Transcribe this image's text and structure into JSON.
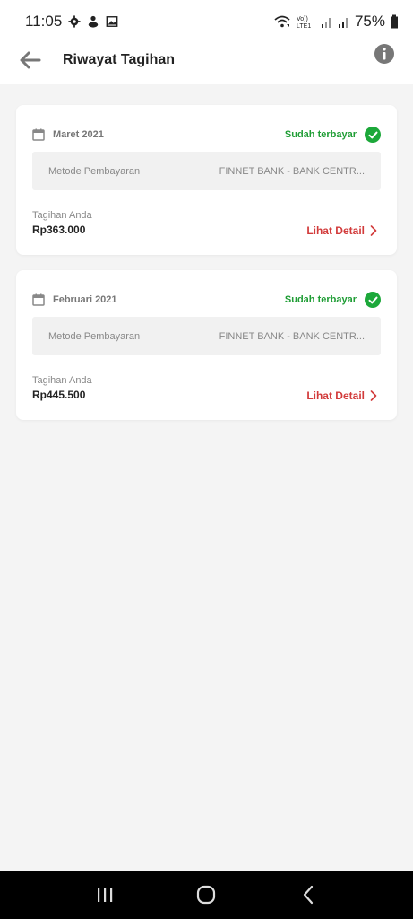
{
  "status_bar": {
    "time": "11:05",
    "battery": "75%",
    "icons": [
      "gear-icon",
      "notification-app-icon",
      "image-icon",
      "wifi-calling-icon",
      "volte-signal-icon",
      "signal-icon",
      "battery-icon"
    ]
  },
  "app_bar": {
    "title": "Riwayat Tagihan",
    "back_icon": "arrow-left-icon",
    "info_icon": "info-icon"
  },
  "bills": [
    {
      "period": "Maret 2021",
      "status": "Sudah terbayar",
      "method_label": "Metode Pembayaran",
      "method_value": "FINNET BANK - BANK CENTR...",
      "bill_label": "Tagihan Anda",
      "amount": "Rp363.000",
      "detail_label": "Lihat Detail"
    },
    {
      "period": "Februari 2021",
      "status": "Sudah terbayar",
      "method_label": "Metode Pembayaran",
      "method_value": "FINNET BANK - BANK CENTR...",
      "bill_label": "Tagihan Anda",
      "amount": "Rp445.500",
      "detail_label": "Lihat Detail"
    }
  ],
  "colors": {
    "paid_green": "#1ca83a",
    "detail_red": "#d23b3b",
    "background": "#f4f4f4"
  },
  "nav_bar": {
    "buttons": [
      "recent-apps-icon",
      "home-icon",
      "back-icon"
    ]
  }
}
